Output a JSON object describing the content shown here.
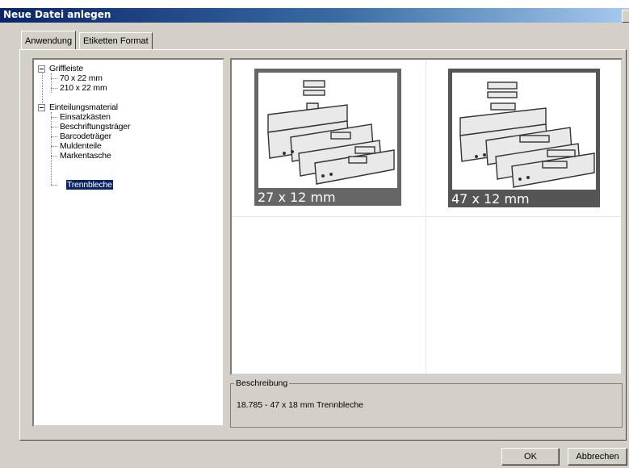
{
  "window": {
    "title": "Neue Datei anlegen"
  },
  "tabs": [
    {
      "label": "Anwendung",
      "active": true
    },
    {
      "label": "Etiketten Format",
      "active": false
    }
  ],
  "tree": {
    "nodes": [
      {
        "label": "Griffleiste",
        "level": 0,
        "expanded": true
      },
      {
        "label": "70 x 22 mm",
        "level": 1
      },
      {
        "label": "210 x 22 mm",
        "level": 1
      },
      {
        "label": "Einteilungsmaterial",
        "level": 0,
        "expanded": true
      },
      {
        "label": "Einsatzkästen",
        "level": 1
      },
      {
        "label": "Beschriftungsträger",
        "level": 1
      },
      {
        "label": "Barcodeträger",
        "level": 1
      },
      {
        "label": "Muldenteile",
        "level": 1
      },
      {
        "label": "Markentasche",
        "level": 1
      },
      {
        "label": "Trennbleche",
        "level": 1,
        "selected": true
      }
    ]
  },
  "thumbnails": [
    {
      "caption": "27 x 12 mm",
      "selected": false
    },
    {
      "caption": "47 x 12 mm",
      "selected": true
    }
  ],
  "description": {
    "legend": "Beschreibung",
    "text": "18.785 - 47 x 18 mm Trennbleche"
  },
  "buttons": {
    "ok": "OK",
    "cancel": "Abbrechen"
  },
  "colors": {
    "titlebar": "#0a246a",
    "selection": "#0a246a",
    "dialog": "#d4d0c8"
  }
}
